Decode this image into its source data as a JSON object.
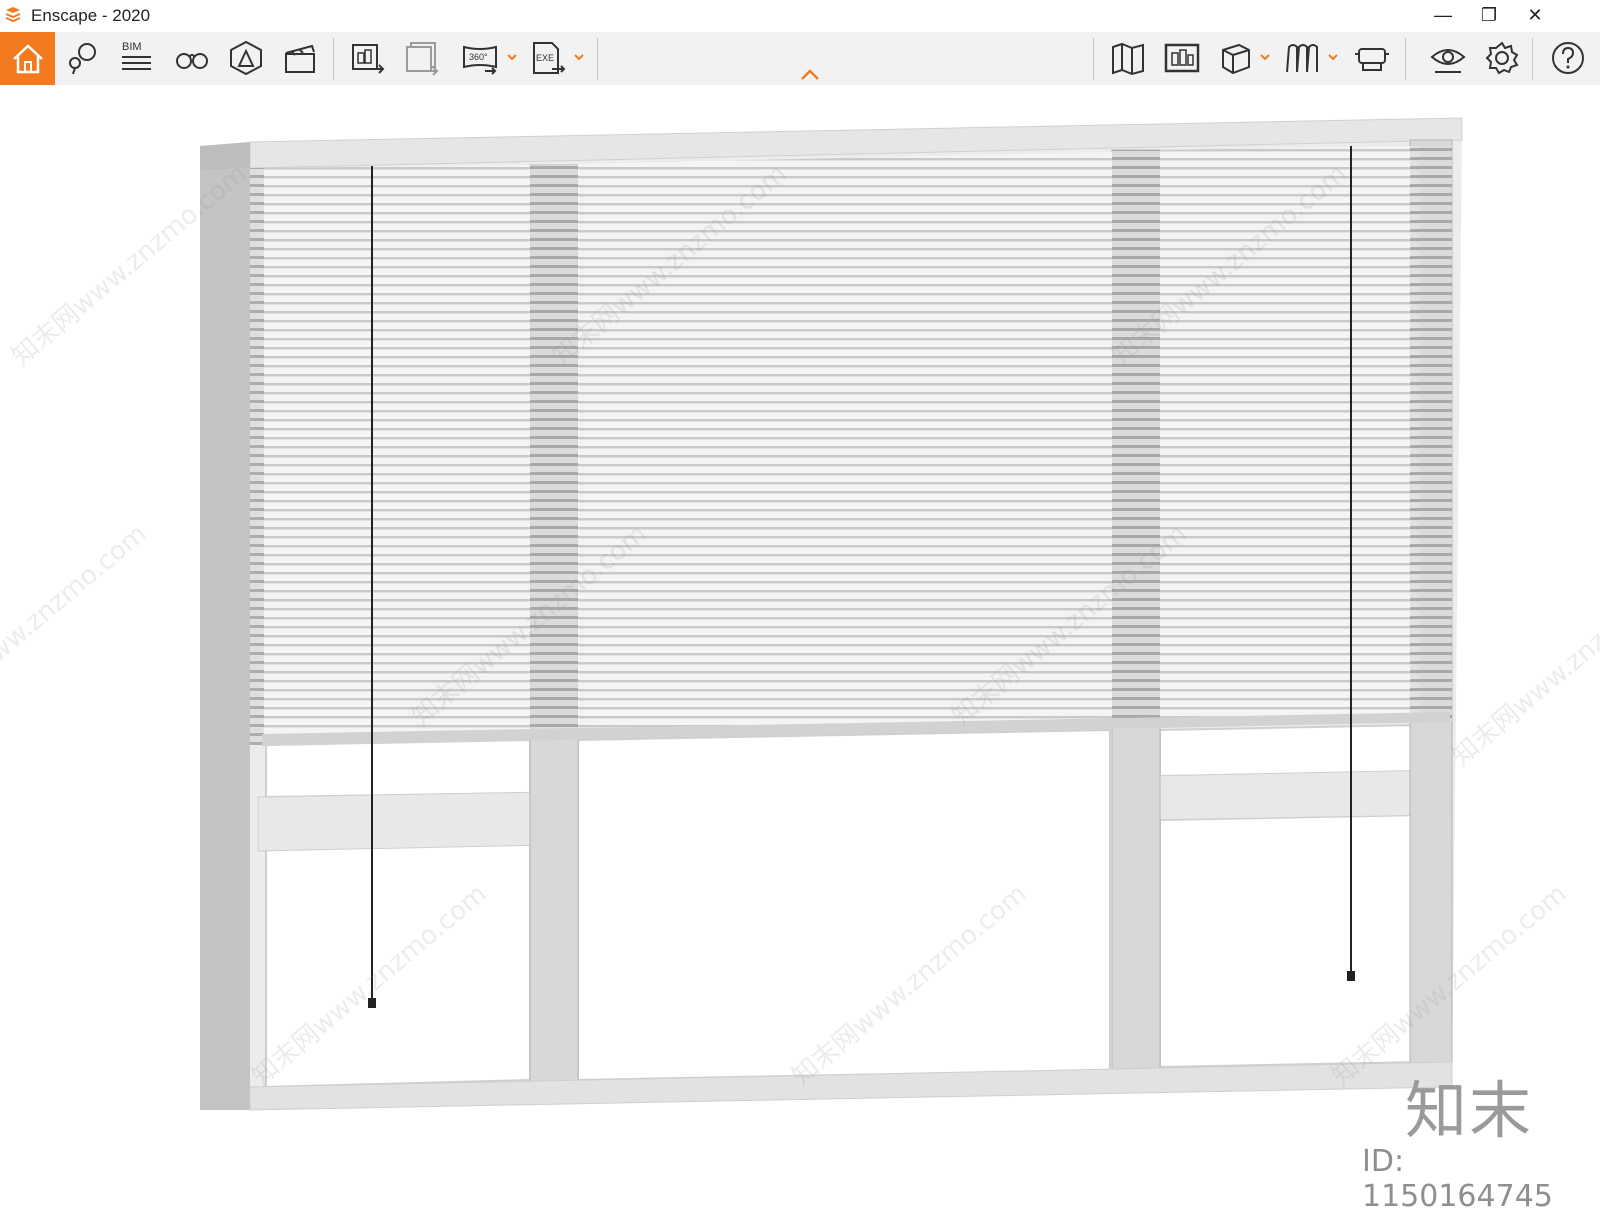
{
  "window": {
    "title": "Enscape - 2020",
    "brand_color": "#f47a20",
    "controls": [
      {
        "name": "minimize",
        "glyph": "—"
      },
      {
        "name": "restore",
        "glyph": "❐"
      },
      {
        "name": "close",
        "glyph": "✕"
      }
    ]
  },
  "toolbar": {
    "left_buttons": [
      {
        "id": "home",
        "icon": "home-icon",
        "active": true
      },
      {
        "id": "location",
        "icon": "map-pin-icon"
      },
      {
        "id": "bim",
        "icon": "bim-info-icon",
        "label": "BIM"
      },
      {
        "id": "views",
        "icon": "binoculars-icon"
      },
      {
        "id": "atmosphere",
        "icon": "atmosphere-icon"
      },
      {
        "id": "video",
        "icon": "clapperboard-icon"
      },
      {
        "id": "screenshot",
        "icon": "render-export-icon"
      },
      {
        "id": "batch",
        "icon": "batch-render-icon"
      },
      {
        "id": "panorama",
        "icon": "panorama-360-icon",
        "label": "360°",
        "dropdown": true
      },
      {
        "id": "exe",
        "icon": "exe-export-icon",
        "label": "EXE",
        "dropdown": true
      }
    ],
    "right_buttons": [
      {
        "id": "minimap",
        "icon": "map-icon"
      },
      {
        "id": "screenshot-view",
        "icon": "view-render-icon"
      },
      {
        "id": "box",
        "icon": "cube-icon",
        "dropdown": true
      },
      {
        "id": "asset-library",
        "icon": "asset-library-icon",
        "dropdown": true
      },
      {
        "id": "vr",
        "icon": "vr-headset-icon"
      },
      {
        "id": "visual-settings",
        "icon": "eye-settings-icon"
      },
      {
        "id": "settings",
        "icon": "gear-icon"
      },
      {
        "id": "help",
        "icon": "help-icon"
      }
    ],
    "collapse_icon": "chevron-up-icon"
  },
  "viewport": {
    "subject": "window-with-venetian-blinds",
    "watermark_text": "知末网www.znzmo.com",
    "brand_mark": "知末",
    "image_id": "ID: 1150164745"
  }
}
